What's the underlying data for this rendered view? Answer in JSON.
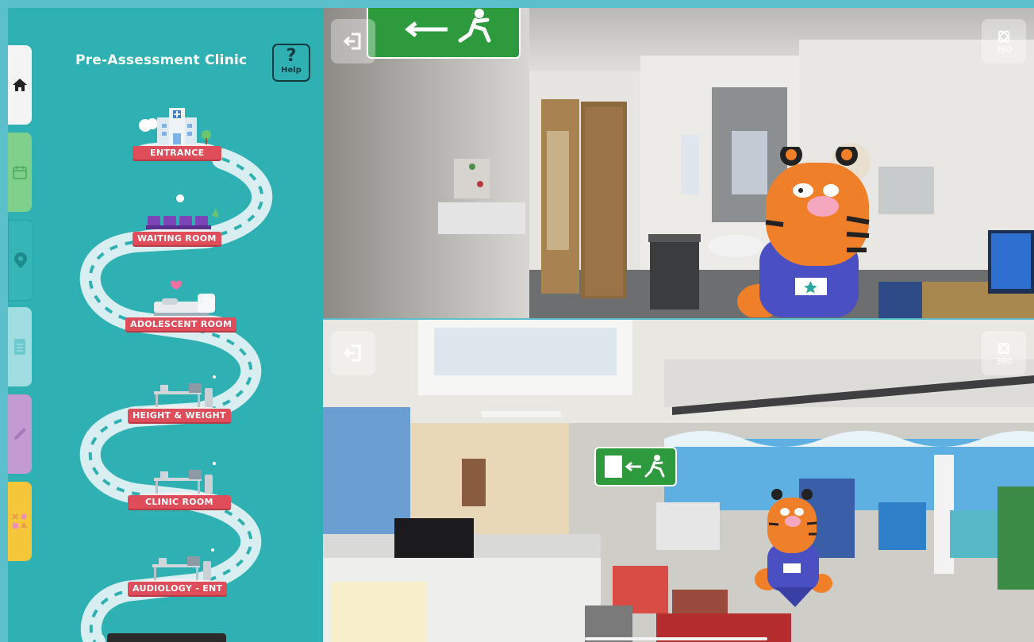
{
  "sidebar": {
    "title": "Pre-Assessment Clinic",
    "help_label": "Help",
    "help_symbol": "?",
    "tabs": [
      {
        "name": "home",
        "icon": "house-icon",
        "color": "#f4f4f4"
      },
      {
        "name": "calendar",
        "icon": "calendar-icon",
        "color": "#7ed08a"
      },
      {
        "name": "map",
        "icon": "map-pin-icon",
        "color": "#35b5b6"
      },
      {
        "name": "document",
        "icon": "document-icon",
        "color": "#9fdde0"
      },
      {
        "name": "pen",
        "icon": "pen-icon",
        "color": "#c39bd2"
      },
      {
        "name": "games",
        "icon": "shapes-icon",
        "color": "#f5c53a"
      }
    ],
    "stations": [
      {
        "label": "ENTRANCE",
        "icon": "hospital-building-icon"
      },
      {
        "label": "WAITING ROOM",
        "icon": "waiting-chairs-icon"
      },
      {
        "label": "ADOLESCENT ROOM",
        "icon": "bed-icon"
      },
      {
        "label": "HEIGHT & WEIGHT",
        "icon": "desk-icon"
      },
      {
        "label": "CLINIC ROOM",
        "icon": "desk-icon"
      },
      {
        "label": "AUDIOLOGY - ENT",
        "icon": "desk-icon"
      }
    ]
  },
  "panels": {
    "top": {
      "exit_icon": "exit-icon",
      "view_label": "360",
      "view_icon": "360-view-icon"
    },
    "bottom": {
      "exit_icon": "exit-icon",
      "view_label": "360",
      "view_icon": "360-view-icon"
    }
  },
  "colors": {
    "sidebar": "#2fb1b3",
    "banner": "#e04d5a",
    "exit_sign": "#2e9a3e",
    "tiger": "#f07f2a",
    "scrubs": "#4a4fc2"
  }
}
